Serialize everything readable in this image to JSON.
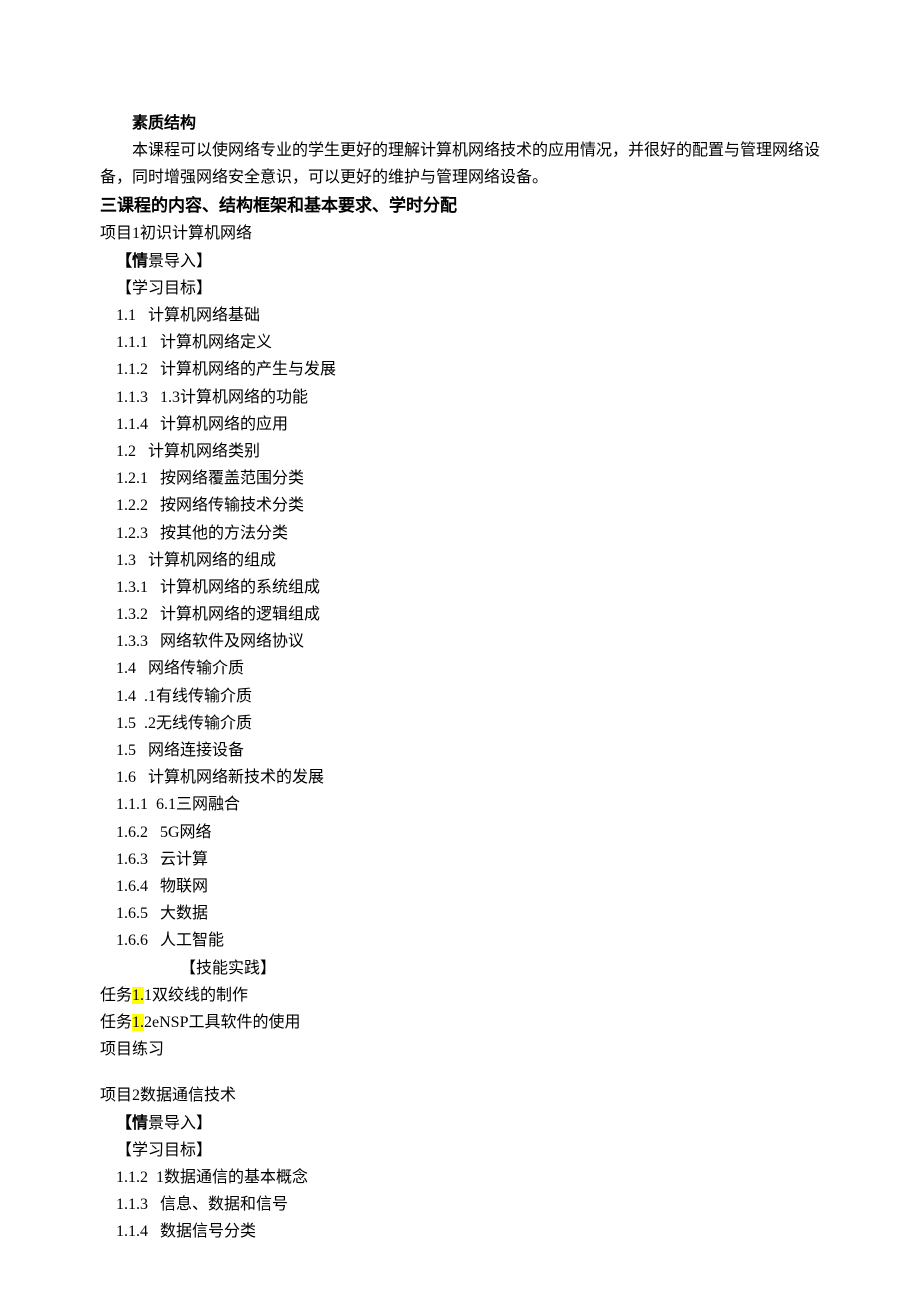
{
  "header": {
    "quality_heading": "素质结构",
    "quality_para": "本课程可以使网络专业的学生更好的理解计算机网络技术的应用情况，并很好的配置与管理网络设备，同时增强网络安全意识，可以更好的维护与管理网络设备。"
  },
  "section3_title": "三课程的内容、结构框架和基本要求、学时分配",
  "project1": {
    "title": "项目1初识计算机网络",
    "scene_marker_open": "【情",
    "scene_marker_rest": "景导入】",
    "goal_marker": "【学习目标】",
    "items": [
      "1.1   计算机网络基础",
      "1.1.1   计算机网络定义",
      "1.1.2   计算机网络的产生与发展",
      "1.1.3   1.3计算机网络的功能",
      "1.1.4   计算机网络的应用",
      "1.2   计算机网络类别",
      "1.2.1   按网络覆盖范围分类",
      "1.2.2   按网络传输技术分类",
      "1.2.3   按其他的方法分类",
      "1.3   计算机网络的组成",
      "1.3.1   计算机网络的系统组成",
      "1.3.2   计算机网络的逻辑组成",
      "1.3.3   网络软件及网络协议",
      "1.4   网络传输介质",
      "1.4  .1有线传输介质",
      "1.5  .2无线传输介质",
      "1.5   网络连接设备",
      "1.6   计算机网络新技术的发展",
      "1.1.1  6.1三网融合",
      "1.6.2   5G网络",
      "1.6.3   云计算",
      "1.6.4   物联网",
      "1.6.5   大数据",
      "1.6.6   人工智能"
    ],
    "skill_marker": "【技能实践】",
    "task1_pre": "任务",
    "task1_hl": "1.",
    "task1_post": "1双绞线的制作",
    "task2_pre": "任务",
    "task2_hl": "1.",
    "task2_post": "2eNSP工具软件的使用",
    "practice": "项目练习"
  },
  "project2": {
    "title": "项目2数据通信技术",
    "scene_marker_open": "【情",
    "scene_marker_rest": "景导入】",
    "goal_marker": "【学习目标】",
    "items": [
      "1.1.2  1数据通信的基本概念",
      "1.1.3   信息、数据和信号",
      "1.1.4   数据信号分类"
    ]
  }
}
